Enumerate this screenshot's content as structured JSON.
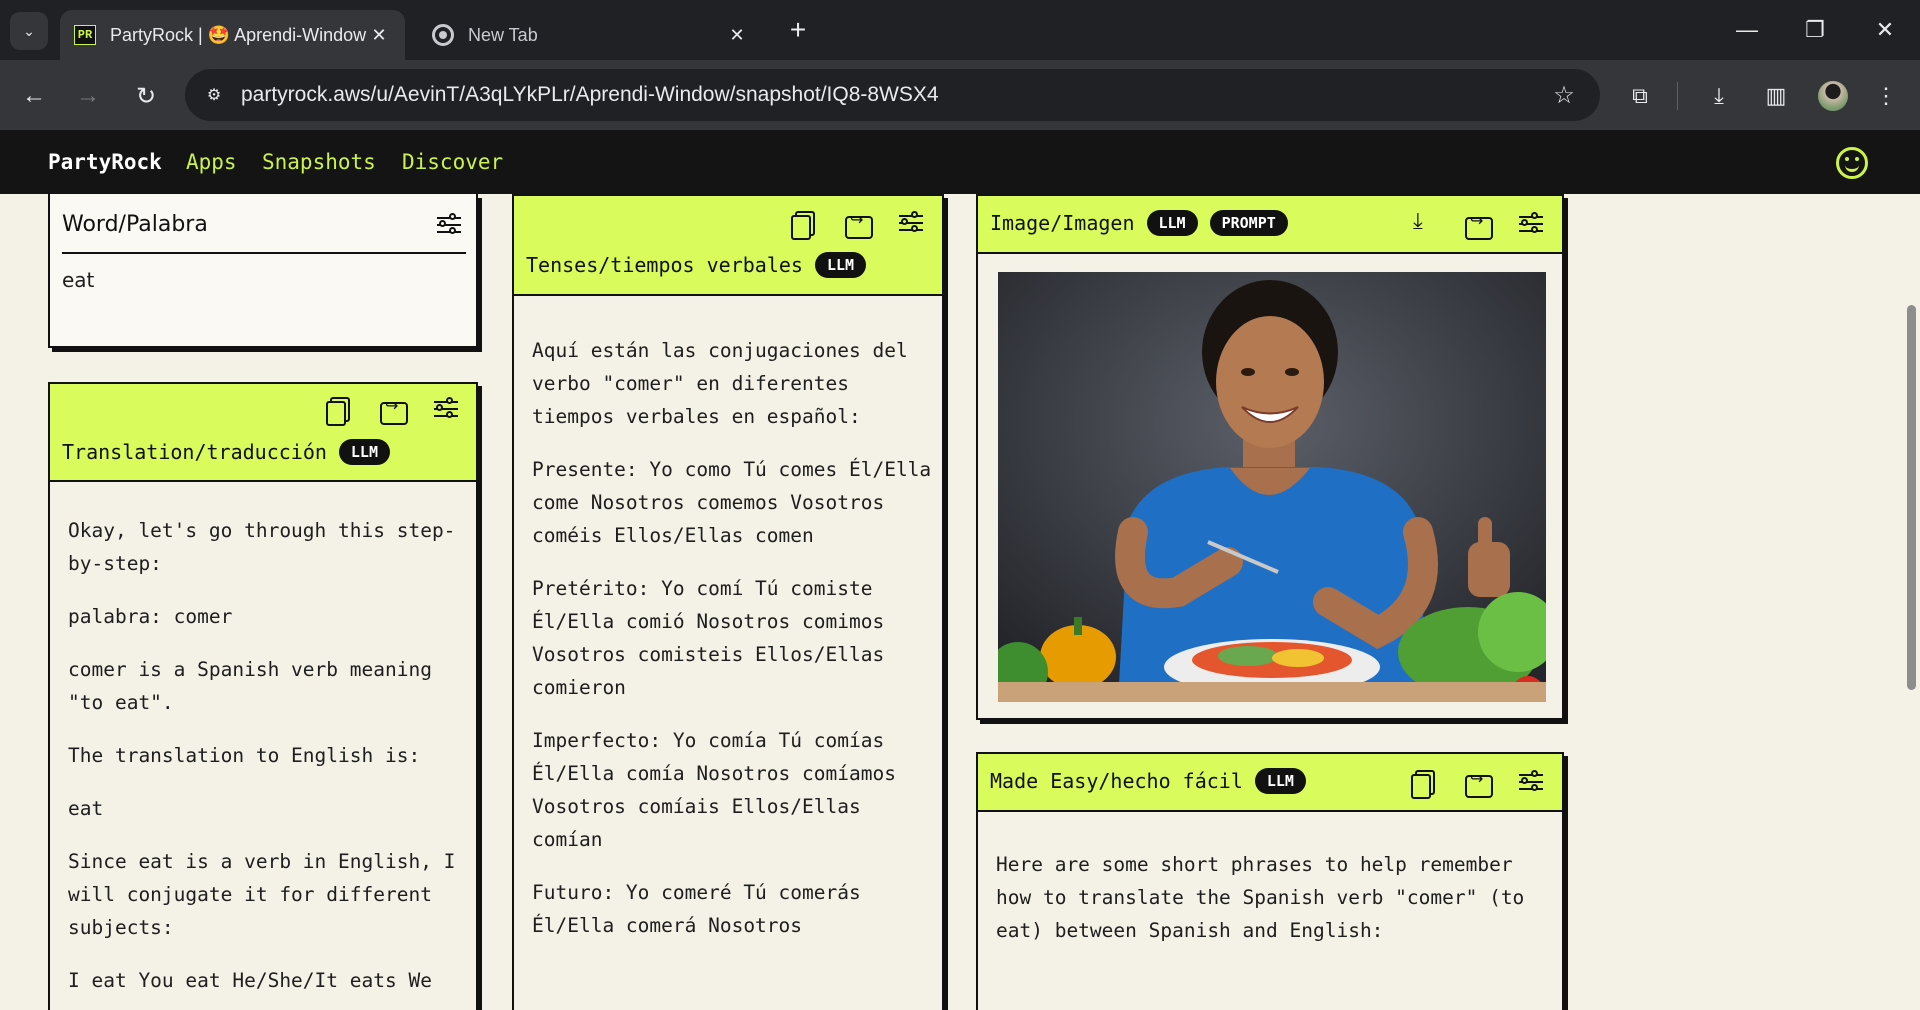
{
  "browser": {
    "tabs": [
      {
        "favicon": "PR",
        "title": "PartyRock | 🤩 Aprendi-Window",
        "close": "✕"
      },
      {
        "title": "New Tab",
        "close": "✕"
      }
    ],
    "new_tab": "+",
    "url": "partyrock.aws/u/AevinT/A3qLYkPLr/Aprendi-Window/snapshot/IQ8-8WSX4"
  },
  "header": {
    "brand": "PartyRock",
    "links": [
      "Apps",
      "Snapshots",
      "Discover"
    ]
  },
  "widgets": {
    "word": {
      "title": "Word/Palabra",
      "value": "eat"
    },
    "translation": {
      "title": "Translation/traducción",
      "badge": "LLM",
      "paragraphs": [
        "Okay, let's go through this step-by-step:",
        "palabra: comer",
        "comer is a Spanish verb meaning \"to eat\".",
        "The translation to English is:",
        "eat",
        "Since eat is a verb in English, I will conjugate it for different subjects:",
        "I eat You eat He/She/It eats We"
      ]
    },
    "tenses": {
      "title": "Tenses/tiempos verbales",
      "badge": "LLM",
      "paragraphs": [
        "Aquí están las conjugaciones del verbo \"comer\" en diferentes tiempos verbales en español:",
        "Presente: Yo como Tú comes Él/Ella come Nosotros comemos Vosotros coméis Ellos/Ellas comen",
        "Pretérito: Yo comí Tú comiste Él/Ella comió Nosotros comimos Vosotros comisteis Ellos/Ellas comieron",
        "Imperfecto: Yo comía Tú comías Él/Ella comía Nosotros comíamos Vosotros comíais Ellos/Ellas comían",
        "Futuro: Yo comeré Tú comerás Él/Ella comerá Nosotros"
      ]
    },
    "image": {
      "title": "Image/Imagen",
      "badge1": "LLM",
      "badge2": "PROMPT"
    },
    "made_easy": {
      "title": "Made Easy/hecho fácil",
      "badge": "LLM",
      "paragraphs": [
        "Here are some short phrases to help remember how to translate the Spanish verb \"comer\" (to eat) between Spanish and English:"
      ]
    }
  },
  "colors": {
    "accent": "#d9fb5c",
    "brand_link": "#ccf34a",
    "page_bg": "#f4f1e6",
    "header_bg": "#141414"
  }
}
